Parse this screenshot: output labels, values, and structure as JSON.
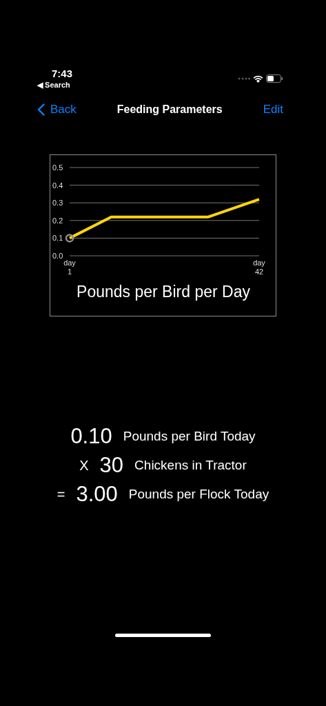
{
  "status_bar": {
    "time": "7:43",
    "back_app": "◀ Search"
  },
  "nav": {
    "back": "Back",
    "title": "Feeding Parameters",
    "action": "Edit"
  },
  "chart": {
    "chart_data": {
      "type": "line",
      "title": "Pounds per Bird per Day",
      "x": [
        1,
        10,
        31,
        42
      ],
      "grid": true,
      "series": [
        {
          "color": "#ffd60a",
          "values": [
            0.1,
            0.22,
            0.22,
            0.32
          ]
        }
      ],
      "xlim": [
        1,
        42
      ],
      "ylim": [
        0,
        0.5
      ],
      "xticks": [
        1,
        42
      ],
      "yticks": [
        {
          "value": 0,
          "label": "0.0"
        },
        {
          "value": 0.1,
          "label": "0.1"
        },
        {
          "value": 0.2,
          "label": "0.2"
        },
        {
          "value": 0.3,
          "label": "0.3"
        },
        {
          "value": 0.4,
          "label": "0.4"
        },
        {
          "value": 0.5,
          "label": "0.5"
        }
      ]
    },
    "x_tick_units": [
      "day",
      "day"
    ]
  },
  "equation": [
    {
      "value": "0.10",
      "label": "Pounds per Bird Today"
    },
    {
      "operator": "X",
      "value": "30",
      "label": "Chickens in Tractor"
    },
    {
      "operator": "=",
      "value": "3.00",
      "label": "Pounds per Flock Today"
    }
  ]
}
